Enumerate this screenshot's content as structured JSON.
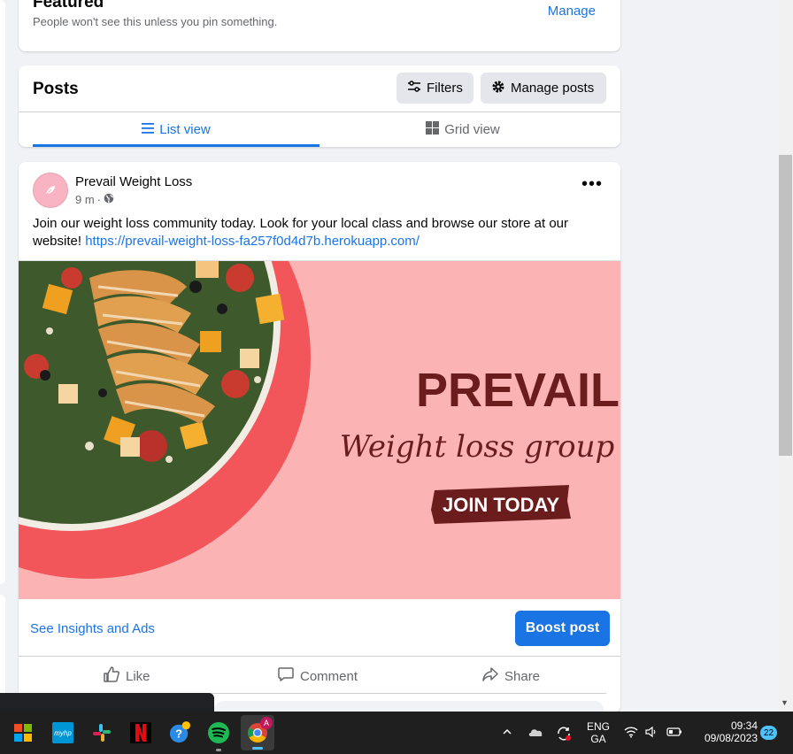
{
  "featured": {
    "title": "Featured",
    "subtitle": "People won't see this unless you pin something.",
    "manage_label": "Manage"
  },
  "posts_header": {
    "title": "Posts",
    "filters_label": "Filters",
    "manage_posts_label": "Manage posts",
    "tabs": [
      {
        "label": "List view",
        "active": true
      },
      {
        "label": "Grid view",
        "active": false
      }
    ]
  },
  "post": {
    "author": "Prevail Weight Loss",
    "time": "9 m",
    "separator": "·",
    "text": "Join our weight loss community today. Look for your local class and browse our store at our website!",
    "link": "https://prevail-weight-loss-fa257f0d4d7b.herokuapp.com/",
    "image": {
      "brand": "PREVAIL",
      "script": "Weight loss group",
      "cta": "JOIN TODAY"
    },
    "insights_label": "See Insights and Ads",
    "boost_label": "Boost post",
    "actions": {
      "like": "Like",
      "comment": "Comment",
      "share": "Share"
    }
  },
  "taskbar": {
    "language_top": "ENG",
    "language_bottom": "GA",
    "time": "09:34",
    "date": "09/08/2023",
    "notification_count": "22",
    "chrome_profile": "A",
    "apps": [
      "windows-start",
      "hp",
      "slack",
      "netflix",
      "help",
      "spotify",
      "chrome"
    ]
  },
  "colors": {
    "accent": "#1b74e4",
    "image_bg": "#fbb3b4",
    "brand_dark": "#6b1d1d"
  }
}
